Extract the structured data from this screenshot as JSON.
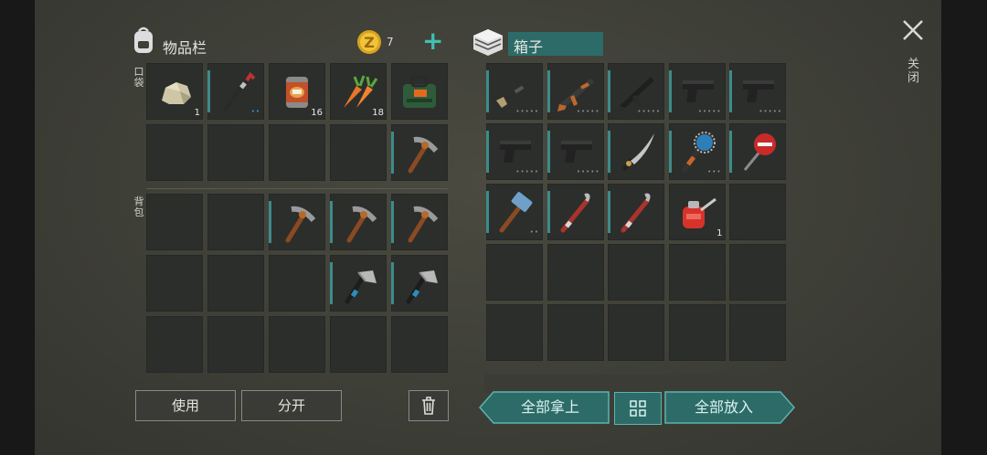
{
  "inventory": {
    "title": "物品栏",
    "coins": "7",
    "add_label": "+",
    "pocket_label": "口袋",
    "backpack_label": "背包",
    "pocket": [
      {
        "icon": "stone-icon",
        "count": "1"
      },
      {
        "icon": "crowbar-icon",
        "dots": "••",
        "dots_color": "blue",
        "equip": true
      },
      {
        "icon": "canned-food-icon",
        "count": "16"
      },
      {
        "icon": "carrot-icon",
        "count": "18"
      },
      {
        "icon": "first-aid-kit-icon"
      },
      null,
      null,
      null,
      null,
      {
        "icon": "pickaxe-icon",
        "equip": true
      }
    ],
    "backpack": [
      null,
      null,
      {
        "icon": "pickaxe-icon",
        "equip": true
      },
      {
        "icon": "pickaxe-icon",
        "equip": true
      },
      {
        "icon": "pickaxe-icon",
        "equip": true
      },
      null,
      null,
      null,
      {
        "icon": "hatchet-icon",
        "equip": true
      },
      {
        "icon": "hatchet-icon",
        "equip": true
      },
      null,
      null,
      null,
      null,
      null
    ],
    "use_label": "使用",
    "split_label": "分开"
  },
  "box": {
    "title": "箱子",
    "slots": [
      {
        "icon": "shotgun-icon",
        "dots": "•••••",
        "equip": true
      },
      {
        "icon": "ak-rifle-icon",
        "dots": "•••••",
        "equip": true
      },
      {
        "icon": "assault-rifle-icon",
        "dots": "•••••",
        "equip": true
      },
      {
        "icon": "pistol-icon",
        "dots": "•••••",
        "equip": true
      },
      {
        "icon": "pistol-icon",
        "dots": "•••••",
        "equip": true
      },
      {
        "icon": "pistol-icon",
        "dots": "•••••",
        "equip": true
      },
      {
        "icon": "pistol-icon",
        "dots": "•••••",
        "equip": true
      },
      {
        "icon": "machete-icon",
        "equip": true
      },
      {
        "icon": "saw-club-icon",
        "dots": "•••",
        "equip": true
      },
      {
        "icon": "stop-sign-icon",
        "equip": true
      },
      {
        "icon": "sledgehammer-icon",
        "dots": "••",
        "equip": true
      },
      {
        "icon": "crowbar-red-icon",
        "equip": true
      },
      {
        "icon": "crowbar-red-icon",
        "equip": true
      },
      {
        "icon": "oil-can-icon",
        "count": "1"
      },
      null
    ],
    "take_all_label": "全部拿上",
    "put_all_label": "全部放入"
  },
  "close_label": "关闭",
  "colors": {
    "accent": "#2d6b69",
    "accent_border": "#5bb5ae",
    "equip_bar": "#3c8c8a"
  }
}
